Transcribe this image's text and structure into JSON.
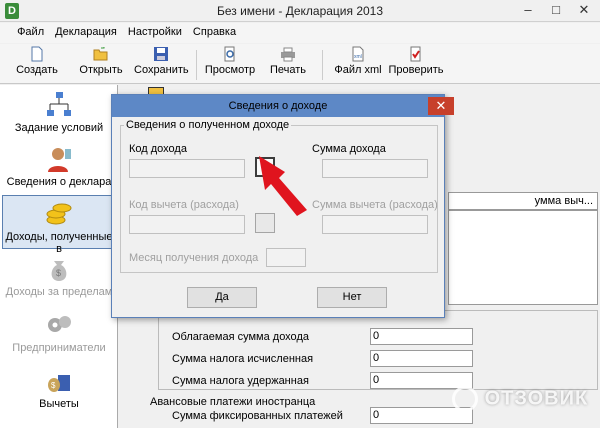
{
  "window": {
    "title": "Без имени - Декларация 2013",
    "app_icon": "D"
  },
  "menu": [
    "Файл",
    "Декларация",
    "Настройки",
    "Справка"
  ],
  "toolbar": {
    "create": "Создать",
    "open": "Открыть",
    "save": "Сохранить",
    "preview": "Просмотр",
    "print": "Печать",
    "xml": "Файл xml",
    "check": "Проверить"
  },
  "sidebar": [
    {
      "label": "Задание условий"
    },
    {
      "label": "Сведения о деклара"
    },
    {
      "label": "Доходы, полученные в"
    },
    {
      "label": "Доходы за пределам"
    },
    {
      "label": "Предприниматели"
    },
    {
      "label": "Вычеты"
    }
  ],
  "content": {
    "tab_partial": "умма выч...",
    "rows": [
      {
        "label": "Облагаемая сумма дохода",
        "value": "0"
      },
      {
        "label": "Сумма налога исчисленная",
        "value": "0"
      },
      {
        "label": "Сумма налога удержанная",
        "value": "0"
      }
    ],
    "advance_title": "Авансовые платежи иностранца",
    "advance_row": {
      "label": "Сумма фиксированных платежей",
      "value": "0"
    }
  },
  "dialog": {
    "title": "Сведения о доходе",
    "group": "Сведения о полученном доходе",
    "income_code": "Код дохода",
    "income_sum": "Сумма дохода",
    "deduction_code": "Код вычета (расхода)",
    "deduction_sum": "Сумма вычета (расхода)",
    "month": "Месяц получения дохода",
    "ok": "Да",
    "cancel": "Нет"
  },
  "colors": {
    "dialog_title": "#5d88c6",
    "close": "#c7402b",
    "arrow": "#e0141e"
  },
  "watermark": "ОТЗОВИК"
}
